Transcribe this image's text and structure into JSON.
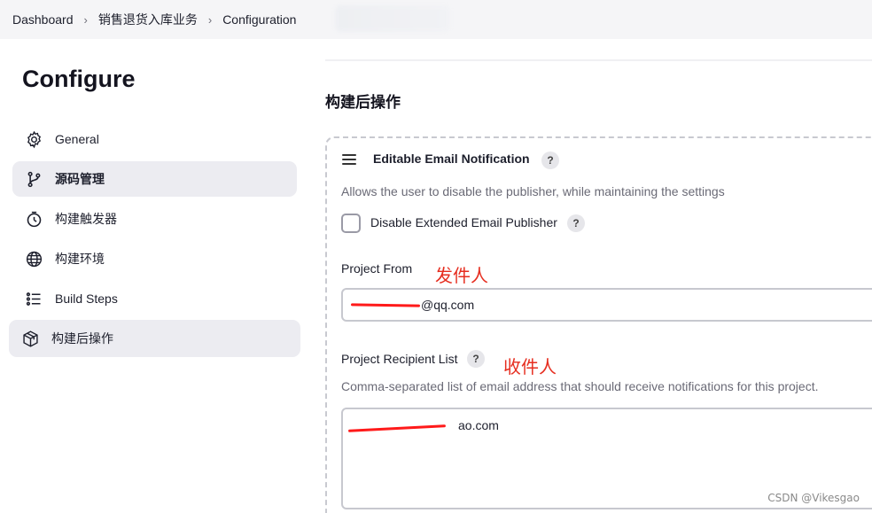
{
  "breadcrumb": [
    "Dashboard",
    "销售退货入库业务",
    "Configuration"
  ],
  "page": {
    "title": "Configure"
  },
  "sidebar": {
    "items": [
      {
        "label": "General",
        "icon": "gear-icon"
      },
      {
        "label": "源码管理",
        "icon": "git-branch-icon"
      },
      {
        "label": "构建触发器",
        "icon": "clock-icon"
      },
      {
        "label": "构建环境",
        "icon": "globe-icon"
      },
      {
        "label": "Build Steps",
        "icon": "list-icon"
      },
      {
        "label": "构建后操作",
        "icon": "package-icon"
      }
    ]
  },
  "section": {
    "title": "构建后操作"
  },
  "notification": {
    "title": "Editable Email Notification",
    "description": "Allows the user to disable the publisher, while maintaining the settings",
    "disable_label": "Disable Extended Email Publisher",
    "disable_checked": false,
    "project_from": {
      "label": "Project From",
      "annotation": "发件人",
      "value_suffix": "@qq.com"
    },
    "recipient_list": {
      "label": "Project Recipient List",
      "annotation": "收件人",
      "description": "Comma-separated list of email address that should receive notifications for this project.",
      "value_suffix": "ao.com"
    }
  },
  "help_glyph": "?",
  "watermark": "CSDN @Vikesgao",
  "colors": {
    "annotation": "#e62d1f",
    "active_nav": "#ececf1"
  }
}
